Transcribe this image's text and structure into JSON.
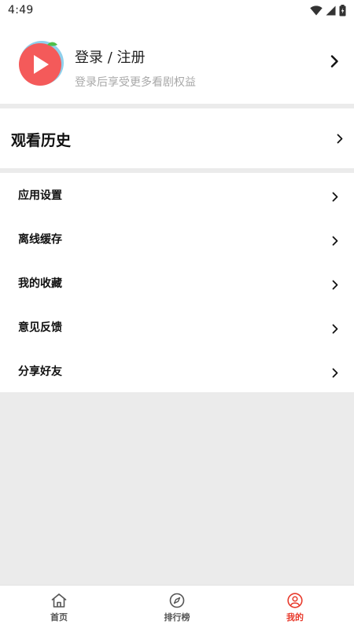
{
  "status_bar": {
    "time": "4:49",
    "icons": [
      "wifi-icon",
      "cellular-signal-icon",
      "battery-icon"
    ]
  },
  "profile": {
    "title": "登录 / 注册",
    "subtitle": "登录后享受更多看剧权益",
    "avatar_icon": "tomato-play-icon"
  },
  "history": {
    "label": "观看历史"
  },
  "menu": {
    "items": [
      {
        "label": "应用设置"
      },
      {
        "label": "离线缓存"
      },
      {
        "label": "我的收藏"
      },
      {
        "label": "意见反馈"
      },
      {
        "label": "分享好友"
      }
    ]
  },
  "tabbar": {
    "tabs": [
      {
        "label": "首页",
        "icon": "home-icon"
      },
      {
        "label": "排行榜",
        "icon": "compass-icon"
      },
      {
        "label": "我的",
        "icon": "user-icon"
      }
    ],
    "active_index": 2
  },
  "colors": {
    "accent": "#e83a2c",
    "avatar_red": "#f45a5a",
    "avatar_ring": "#8fd0ec",
    "background": "#ebebeb"
  }
}
